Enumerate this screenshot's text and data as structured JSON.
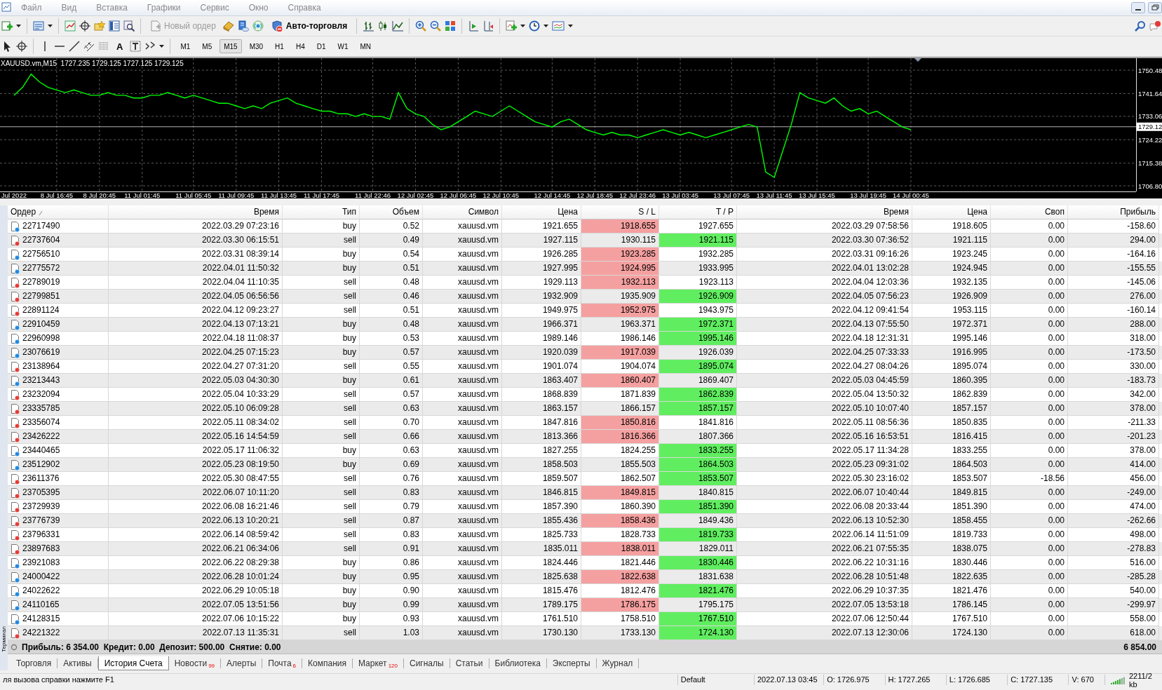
{
  "menu": [
    {
      "label": "Файл"
    },
    {
      "label": "Вид"
    },
    {
      "label": "Вставка"
    },
    {
      "label": "Графики"
    },
    {
      "label": "Сервис"
    },
    {
      "label": "Окно"
    },
    {
      "label": "Справка"
    }
  ],
  "toolbar": {
    "new_order": {
      "label": "Новый ордер",
      "disabled": true
    },
    "autotrading": {
      "label": "Авто-торговля"
    },
    "text_tool": "A",
    "timeframes": [
      {
        "label": "M1",
        "selected": false
      },
      {
        "label": "M5",
        "selected": false
      },
      {
        "label": "M15",
        "selected": true
      },
      {
        "label": "M30",
        "selected": false
      },
      {
        "label": "H1",
        "selected": false
      },
      {
        "label": "H4",
        "selected": false
      },
      {
        "label": "D1",
        "selected": false
      },
      {
        "label": "W1",
        "selected": false
      },
      {
        "label": "MN",
        "selected": false
      }
    ]
  },
  "chart": {
    "title": "XAUUSD.vm,M15  1727.235 1729.125 1727.125 1729.125",
    "chart_data": {
      "type": "line",
      "grid": true,
      "ref_lines": [
        {
          "axis": "y",
          "value": 1729.12,
          "label": "1729.12",
          "color": "#b0b0b0"
        }
      ],
      "ylim": [
        1704.7,
        1755
      ],
      "categories": [
        "Jul 2022",
        null,
        null,
        null,
        null,
        "8 Jul 16:45",
        null,
        null,
        null,
        null,
        "8 Jul 20:45",
        null,
        null,
        null,
        null,
        "11 Jul 01:45",
        null,
        null,
        null,
        null,
        null,
        "11 Jul 05:45",
        null,
        null,
        null,
        null,
        "11 Jul 09:45",
        null,
        null,
        null,
        null,
        "11 Jul 13:45",
        null,
        null,
        null,
        null,
        "11 Jul 17:45",
        null,
        null,
        null,
        null,
        null,
        "11 Jul 22:46",
        null,
        null,
        null,
        null,
        "12 Jul 02:45",
        null,
        null,
        null,
        null,
        "12 Jul 06:45",
        null,
        null,
        null,
        null,
        "12 Jul 10:45",
        null,
        null,
        null,
        null,
        null,
        "12 Jul 14:45",
        null,
        null,
        null,
        null,
        "12 Jul 18:45",
        null,
        null,
        null,
        null,
        "12 Jul 23:46",
        null,
        null,
        null,
        null,
        "13 Jul 03:45",
        null,
        null,
        null,
        null,
        null,
        "13 Jul 07:45",
        null,
        null,
        null,
        null,
        "13 Jul 11:45",
        null,
        null,
        null,
        null,
        "13 Jul 15:45",
        null,
        null,
        null,
        null,
        null,
        "13 Jul 19:45",
        null,
        null,
        null,
        null,
        "14 Jul 00:45"
      ],
      "yticks": [
        {
          "value": 1750.48,
          "label": "1750.48"
        },
        {
          "value": 1741.64,
          "label": "1741.64"
        },
        {
          "value": 1733.06,
          "label": "1733.06"
        },
        {
          "value": 1724.22,
          "label": "1724.22"
        },
        {
          "value": 1715.38,
          "label": "1715.38"
        },
        {
          "value": 1706.8,
          "label": "1706.80"
        }
      ],
      "series": [
        {
          "color": "#00ff00",
          "values": [
            1741,
            1744,
            1749,
            1746,
            1744,
            1743,
            1742,
            1743,
            1742,
            1741,
            1741,
            1742,
            1741,
            1741,
            1740,
            1740,
            1741,
            1741,
            1742,
            1741,
            1740,
            1741,
            1740,
            1739,
            1738,
            1738,
            1737,
            1736,
            1737,
            1736,
            1738,
            1739,
            1740,
            1738,
            1737,
            1736,
            1735,
            1735,
            1734,
            1734,
            1733,
            1734,
            1733,
            1733,
            1732,
            1742,
            1736,
            1734,
            1733,
            1730,
            1728,
            1729,
            1731,
            1733,
            1735,
            1734,
            1733,
            1735,
            1737,
            1735,
            1733,
            1731,
            1730,
            1729,
            1731,
            1732,
            1730,
            1728,
            1727,
            1726,
            1727,
            1726,
            1726,
            1725,
            1726,
            1727,
            1728,
            1727,
            1726,
            1727,
            1726,
            1725,
            1726,
            1727,
            1728,
            1729,
            1730,
            1729,
            1712,
            1710,
            1720,
            1730,
            1742,
            1740,
            1739,
            1738,
            1740,
            1737,
            1735,
            1736,
            1734,
            1735,
            1733,
            1731,
            1729,
            1728
          ]
        }
      ]
    }
  },
  "table": {
    "columns": [
      {
        "label": "Ордер",
        "sorted": true
      },
      {
        "label": "Время",
        "sorted": false
      },
      {
        "label": "Тип",
        "sorted": false
      },
      {
        "label": "Объем",
        "sorted": false
      },
      {
        "label": "Символ",
        "sorted": false
      },
      {
        "label": "Цена",
        "sorted": false
      },
      {
        "label": "S / L",
        "sorted": false
      },
      {
        "label": "T / P",
        "sorted": false
      },
      {
        "label": "Время",
        "sorted": false
      },
      {
        "label": "Цена",
        "sorted": false
      },
      {
        "label": "Своп",
        "sorted": false
      },
      {
        "label": "Прибыль",
        "sorted": false
      }
    ],
    "rows": [
      {
        "order": "22717490",
        "open_time": "2022.03.29 07:23:16",
        "type": "buy",
        "kind": "buy",
        "volume": "0.52",
        "symbol": "xauusd.vm",
        "open_price": "1921.655",
        "sl": "1918.655",
        "tp": "1927.655",
        "close_time": "2022.03.29 07:58:56",
        "close_price": "1918.605",
        "swap": "0.00",
        "profit": "-158.60",
        "sl_hit": true,
        "tp_hit": false
      },
      {
        "order": "22737604",
        "open_time": "2022.03.30 06:15:51",
        "type": "sell",
        "kind": "sell",
        "volume": "0.49",
        "symbol": "xauusd.vm",
        "open_price": "1927.115",
        "sl": "1930.115",
        "tp": "1921.115",
        "close_time": "2022.03.30 07:36:52",
        "close_price": "1921.115",
        "swap": "0.00",
        "profit": "294.00",
        "sl_hit": false,
        "tp_hit": true
      },
      {
        "order": "22756510",
        "open_time": "2022.03.31 08:39:14",
        "type": "buy",
        "kind": "buy",
        "volume": "0.54",
        "symbol": "xauusd.vm",
        "open_price": "1926.285",
        "sl": "1923.285",
        "tp": "1932.285",
        "close_time": "2022.03.31 09:16:26",
        "close_price": "1923.245",
        "swap": "0.00",
        "profit": "-164.16",
        "sl_hit": true,
        "tp_hit": false
      },
      {
        "order": "22775572",
        "open_time": "2022.04.01 11:50:32",
        "type": "buy",
        "kind": "buy",
        "volume": "0.51",
        "symbol": "xauusd.vm",
        "open_price": "1927.995",
        "sl": "1924.995",
        "tp": "1933.995",
        "close_time": "2022.04.01 13:02:28",
        "close_price": "1924.945",
        "swap": "0.00",
        "profit": "-155.55",
        "sl_hit": true,
        "tp_hit": false
      },
      {
        "order": "22789019",
        "open_time": "2022.04.04 11:10:35",
        "type": "sell",
        "kind": "sell",
        "volume": "0.48",
        "symbol": "xauusd.vm",
        "open_price": "1929.113",
        "sl": "1932.113",
        "tp": "1923.113",
        "close_time": "2022.04.04 12:03:36",
        "close_price": "1932.135",
        "swap": "0.00",
        "profit": "-145.06",
        "sl_hit": true,
        "tp_hit": false
      },
      {
        "order": "22799851",
        "open_time": "2022.04.05 06:56:56",
        "type": "sell",
        "kind": "sell",
        "volume": "0.46",
        "symbol": "xauusd.vm",
        "open_price": "1932.909",
        "sl": "1935.909",
        "tp": "1926.909",
        "close_time": "2022.04.05 07:56:23",
        "close_price": "1926.909",
        "swap": "0.00",
        "profit": "276.00",
        "sl_hit": false,
        "tp_hit": true
      },
      {
        "order": "22891124",
        "open_time": "2022.04.12 09:23:27",
        "type": "sell",
        "kind": "sell",
        "volume": "0.51",
        "symbol": "xauusd.vm",
        "open_price": "1949.975",
        "sl": "1952.975",
        "tp": "1943.975",
        "close_time": "2022.04.12 09:41:54",
        "close_price": "1953.115",
        "swap": "0.00",
        "profit": "-160.14",
        "sl_hit": true,
        "tp_hit": false
      },
      {
        "order": "22910459",
        "open_time": "2022.04.13 07:13:21",
        "type": "buy",
        "kind": "buy",
        "volume": "0.48",
        "symbol": "xauusd.vm",
        "open_price": "1966.371",
        "sl": "1963.371",
        "tp": "1972.371",
        "close_time": "2022.04.13 07:55:50",
        "close_price": "1972.371",
        "swap": "0.00",
        "profit": "288.00",
        "sl_hit": false,
        "tp_hit": true
      },
      {
        "order": "22960998",
        "open_time": "2022.04.18 11:08:37",
        "type": "buy",
        "kind": "buy",
        "volume": "0.53",
        "symbol": "xauusd.vm",
        "open_price": "1989.146",
        "sl": "1986.146",
        "tp": "1995.146",
        "close_time": "2022.04.18 12:31:31",
        "close_price": "1995.146",
        "swap": "0.00",
        "profit": "318.00",
        "sl_hit": false,
        "tp_hit": true
      },
      {
        "order": "23076619",
        "open_time": "2022.04.25 07:15:23",
        "type": "buy",
        "kind": "buy",
        "volume": "0.57",
        "symbol": "xauusd.vm",
        "open_price": "1920.039",
        "sl": "1917.039",
        "tp": "1926.039",
        "close_time": "2022.04.25 07:33:33",
        "close_price": "1916.995",
        "swap": "0.00",
        "profit": "-173.50",
        "sl_hit": true,
        "tp_hit": false
      },
      {
        "order": "23138964",
        "open_time": "2022.04.27 07:31:20",
        "type": "sell",
        "kind": "sell",
        "volume": "0.55",
        "symbol": "xauusd.vm",
        "open_price": "1901.074",
        "sl": "1904.074",
        "tp": "1895.074",
        "close_time": "2022.04.27 08:04:26",
        "close_price": "1895.074",
        "swap": "0.00",
        "profit": "330.00",
        "sl_hit": false,
        "tp_hit": true
      },
      {
        "order": "23213443",
        "open_time": "2022.05.03 04:30:30",
        "type": "buy",
        "kind": "buy",
        "volume": "0.61",
        "symbol": "xauusd.vm",
        "open_price": "1863.407",
        "sl": "1860.407",
        "tp": "1869.407",
        "close_time": "2022.05.03 04:45:59",
        "close_price": "1860.395",
        "swap": "0.00",
        "profit": "-183.73",
        "sl_hit": true,
        "tp_hit": false
      },
      {
        "order": "23232094",
        "open_time": "2022.05.04 10:33:29",
        "type": "sell",
        "kind": "sell",
        "volume": "0.57",
        "symbol": "xauusd.vm",
        "open_price": "1868.839",
        "sl": "1871.839",
        "tp": "1862.839",
        "close_time": "2022.05.04 13:50:32",
        "close_price": "1862.839",
        "swap": "0.00",
        "profit": "342.00",
        "sl_hit": false,
        "tp_hit": true
      },
      {
        "order": "23335785",
        "open_time": "2022.05.10 06:09:28",
        "type": "sell",
        "kind": "sell",
        "volume": "0.63",
        "symbol": "xauusd.vm",
        "open_price": "1863.157",
        "sl": "1866.157",
        "tp": "1857.157",
        "close_time": "2022.05.10 10:07:40",
        "close_price": "1857.157",
        "swap": "0.00",
        "profit": "378.00",
        "sl_hit": false,
        "tp_hit": true
      },
      {
        "order": "23356074",
        "open_time": "2022.05.11 08:34:02",
        "type": "sell",
        "kind": "sell",
        "volume": "0.70",
        "symbol": "xauusd.vm",
        "open_price": "1847.816",
        "sl": "1850.816",
        "tp": "1841.816",
        "close_time": "2022.05.11 08:56:36",
        "close_price": "1850.835",
        "swap": "0.00",
        "profit": "-211.33",
        "sl_hit": true,
        "tp_hit": false
      },
      {
        "order": "23426222",
        "open_time": "2022.05.16 14:54:59",
        "type": "sell",
        "kind": "sell",
        "volume": "0.66",
        "symbol": "xauusd.vm",
        "open_price": "1813.366",
        "sl": "1816.366",
        "tp": "1807.366",
        "close_time": "2022.05.16 16:53:51",
        "close_price": "1816.415",
        "swap": "0.00",
        "profit": "-201.23",
        "sl_hit": true,
        "tp_hit": false
      },
      {
        "order": "23440465",
        "open_time": "2022.05.17 11:06:32",
        "type": "buy",
        "kind": "buy",
        "volume": "0.63",
        "symbol": "xauusd.vm",
        "open_price": "1827.255",
        "sl": "1824.255",
        "tp": "1833.255",
        "close_time": "2022.05.17 11:34:28",
        "close_price": "1833.255",
        "swap": "0.00",
        "profit": "378.00",
        "sl_hit": false,
        "tp_hit": true
      },
      {
        "order": "23512902",
        "open_time": "2022.05.23 08:19:50",
        "type": "buy",
        "kind": "buy",
        "volume": "0.69",
        "symbol": "xauusd.vm",
        "open_price": "1858.503",
        "sl": "1855.503",
        "tp": "1864.503",
        "close_time": "2022.05.23 09:31:02",
        "close_price": "1864.503",
        "swap": "0.00",
        "profit": "414.00",
        "sl_hit": false,
        "tp_hit": true
      },
      {
        "order": "23611376",
        "open_time": "2022.05.30 08:47:55",
        "type": "sell",
        "kind": "sell",
        "volume": "0.76",
        "symbol": "xauusd.vm",
        "open_price": "1859.507",
        "sl": "1862.507",
        "tp": "1853.507",
        "close_time": "2022.05.30 23:16:02",
        "close_price": "1853.507",
        "swap": "-18.56",
        "profit": "456.00",
        "sl_hit": false,
        "tp_hit": true
      },
      {
        "order": "23705395",
        "open_time": "2022.06.07 10:11:20",
        "type": "sell",
        "kind": "sell",
        "volume": "0.83",
        "symbol": "xauusd.vm",
        "open_price": "1846.815",
        "sl": "1849.815",
        "tp": "1840.815",
        "close_time": "2022.06.07 10:40:44",
        "close_price": "1849.815",
        "swap": "0.00",
        "profit": "-249.00",
        "sl_hit": true,
        "tp_hit": false
      },
      {
        "order": "23729939",
        "open_time": "2022.06.08 16:21:46",
        "type": "sell",
        "kind": "sell",
        "volume": "0.79",
        "symbol": "xauusd.vm",
        "open_price": "1857.390",
        "sl": "1860.390",
        "tp": "1851.390",
        "close_time": "2022.06.08 20:33:44",
        "close_price": "1851.390",
        "swap": "0.00",
        "profit": "474.00",
        "sl_hit": false,
        "tp_hit": true
      },
      {
        "order": "23776739",
        "open_time": "2022.06.13 10:20:21",
        "type": "sell",
        "kind": "sell",
        "volume": "0.87",
        "symbol": "xauusd.vm",
        "open_price": "1855.436",
        "sl": "1858.436",
        "tp": "1849.436",
        "close_time": "2022.06.13 10:52:30",
        "close_price": "1858.455",
        "swap": "0.00",
        "profit": "-262.66",
        "sl_hit": true,
        "tp_hit": false
      },
      {
        "order": "23796331",
        "open_time": "2022.06.14 08:59:42",
        "type": "sell",
        "kind": "sell",
        "volume": "0.83",
        "symbol": "xauusd.vm",
        "open_price": "1825.733",
        "sl": "1828.733",
        "tp": "1819.733",
        "close_time": "2022.06.14 11:51:09",
        "close_price": "1819.733",
        "swap": "0.00",
        "profit": "498.00",
        "sl_hit": false,
        "tp_hit": true
      },
      {
        "order": "23897683",
        "open_time": "2022.06.21 06:34:06",
        "type": "sell",
        "kind": "sell",
        "volume": "0.91",
        "symbol": "xauusd.vm",
        "open_price": "1835.011",
        "sl": "1838.011",
        "tp": "1829.011",
        "close_time": "2022.06.21 07:55:35",
        "close_price": "1838.075",
        "swap": "0.00",
        "profit": "-278.83",
        "sl_hit": true,
        "tp_hit": false
      },
      {
        "order": "23921083",
        "open_time": "2022.06.22 08:29:38",
        "type": "buy",
        "kind": "buy",
        "volume": "0.86",
        "symbol": "xauusd.vm",
        "open_price": "1824.446",
        "sl": "1821.446",
        "tp": "1830.446",
        "close_time": "2022.06.22 10:31:16",
        "close_price": "1830.446",
        "swap": "0.00",
        "profit": "516.00",
        "sl_hit": false,
        "tp_hit": true
      },
      {
        "order": "24000422",
        "open_time": "2022.06.28 10:01:24",
        "type": "buy",
        "kind": "buy",
        "volume": "0.95",
        "symbol": "xauusd.vm",
        "open_price": "1825.638",
        "sl": "1822.638",
        "tp": "1831.638",
        "close_time": "2022.06.28 10:51:48",
        "close_price": "1822.635",
        "swap": "0.00",
        "profit": "-285.28",
        "sl_hit": true,
        "tp_hit": false
      },
      {
        "order": "24022622",
        "open_time": "2022.06.29 10:05:18",
        "type": "buy",
        "kind": "buy",
        "volume": "0.90",
        "symbol": "xauusd.vm",
        "open_price": "1815.476",
        "sl": "1812.476",
        "tp": "1821.476",
        "close_time": "2022.06.29 10:37:35",
        "close_price": "1821.476",
        "swap": "0.00",
        "profit": "540.00",
        "sl_hit": false,
        "tp_hit": true
      },
      {
        "order": "24110165",
        "open_time": "2022.07.05 13:51:56",
        "type": "buy",
        "kind": "buy",
        "volume": "0.99",
        "symbol": "xauusd.vm",
        "open_price": "1789.175",
        "sl": "1786.175",
        "tp": "1795.175",
        "close_time": "2022.07.05 13:53:18",
        "close_price": "1786.145",
        "swap": "0.00",
        "profit": "-299.97",
        "sl_hit": true,
        "tp_hit": false
      },
      {
        "order": "24128315",
        "open_time": "2022.07.06 10:15:22",
        "type": "buy",
        "kind": "buy",
        "volume": "0.93",
        "symbol": "xauusd.vm",
        "open_price": "1761.510",
        "sl": "1758.510",
        "tp": "1767.510",
        "close_time": "2022.07.06 12:50:44",
        "close_price": "1767.510",
        "swap": "0.00",
        "profit": "558.00",
        "sl_hit": false,
        "tp_hit": true
      },
      {
        "order": "24221322",
        "open_time": "2022.07.13 11:35:31",
        "type": "sell",
        "kind": "sell",
        "volume": "1.03",
        "symbol": "xauusd.vm",
        "open_price": "1730.130",
        "sl": "1733.130",
        "tp": "1724.130",
        "close_time": "2022.07.13 12:30:06",
        "close_price": "1724.130",
        "swap": "0.00",
        "profit": "618.00",
        "sl_hit": false,
        "tp_hit": true
      }
    ]
  },
  "summary": {
    "text": "Прибыль: 6 354.00  Кредит: 0.00  Депозит: 500.00  Снятие: 0.00",
    "total": "6 854.00"
  },
  "side_tab": "Терминал",
  "tabs": [
    {
      "label": "Торговля",
      "selected": false
    },
    {
      "label": "Активы",
      "selected": false
    },
    {
      "label": "История Счета",
      "selected": true
    },
    {
      "label": "Новости",
      "badge": "99",
      "selected": false
    },
    {
      "label": "Алерты",
      "selected": false
    },
    {
      "label": "Почта",
      "badge": "6",
      "selected": false
    },
    {
      "label": "Компания",
      "selected": false
    },
    {
      "label": "Маркет",
      "badge": "120",
      "selected": false
    },
    {
      "label": "Сигналы",
      "selected": false
    },
    {
      "label": "Статьи",
      "selected": false
    },
    {
      "label": "Библиотека",
      "selected": false
    },
    {
      "label": "Эксперты",
      "selected": false
    },
    {
      "label": "Журнал",
      "selected": false
    }
  ],
  "status": {
    "help": "ля вызова справки нажмите F1",
    "profile": "Default",
    "time": "2022.07.13 03:45",
    "open": "O: 1726.975",
    "high": "H: 1727.265",
    "low": "L: 1726.685",
    "close": "C: 1727.135",
    "volume": "V: 670",
    "traffic": "2211/2 kb"
  }
}
